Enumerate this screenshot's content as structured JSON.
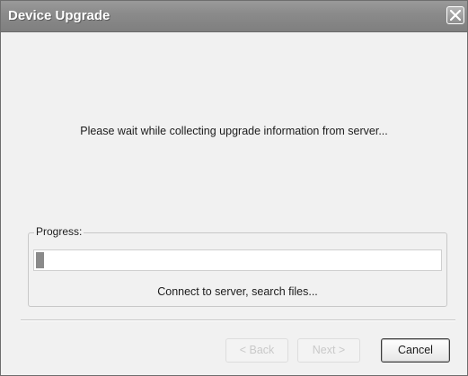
{
  "window": {
    "title": "Device Upgrade"
  },
  "main": {
    "message": "Please wait while collecting upgrade information from server..."
  },
  "progress": {
    "label": "Progress:",
    "value_fraction": 0.02,
    "status_text": "Connect to server, search files..."
  },
  "buttons": {
    "back_label": "< Back",
    "next_label": "Next >",
    "cancel_label": "Cancel"
  },
  "icons": {
    "close": "close-icon"
  },
  "colors": {
    "titlebar": "#8b8b8b",
    "window_bg": "#f1f1f1",
    "progress_fill": "#8a8a8a"
  }
}
